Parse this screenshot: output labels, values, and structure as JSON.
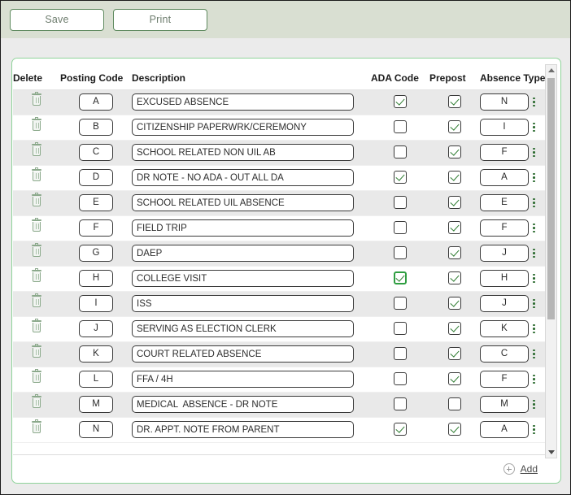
{
  "toolbar": {
    "save_label": "Save",
    "print_label": "Print"
  },
  "grid": {
    "columns": {
      "delete": "Delete",
      "posting_code": "Posting Code",
      "description": "Description",
      "ada_code": "ADA Code",
      "prepost": "Prepost",
      "absence_type": "Absence Type"
    },
    "rows": [
      {
        "delete_icon": "trash-icon",
        "posting_code": "A",
        "description": "EXCUSED ABSENCE",
        "ada_code": true,
        "prepost": true,
        "absence_type": "N",
        "ada_focused": false
      },
      {
        "delete_icon": "trash-icon",
        "posting_code": "B",
        "description": "CITIZENSHIP PAPERWRK/CEREMONY",
        "ada_code": false,
        "prepost": true,
        "absence_type": "I",
        "ada_focused": false
      },
      {
        "delete_icon": "trash-icon",
        "posting_code": "C",
        "description": "SCHOOL RELATED NON UIL AB",
        "ada_code": false,
        "prepost": true,
        "absence_type": "F",
        "ada_focused": false
      },
      {
        "delete_icon": "trash-icon",
        "posting_code": "D",
        "description": "DR NOTE - NO ADA - OUT ALL DA",
        "ada_code": true,
        "prepost": true,
        "absence_type": "A",
        "ada_focused": false
      },
      {
        "delete_icon": "trash-icon",
        "posting_code": "E",
        "description": "SCHOOL RELATED UIL ABSENCE",
        "ada_code": false,
        "prepost": true,
        "absence_type": "E",
        "ada_focused": false
      },
      {
        "delete_icon": "trash-icon",
        "posting_code": "F",
        "description": "FIELD TRIP",
        "ada_code": false,
        "prepost": true,
        "absence_type": "F",
        "ada_focused": false
      },
      {
        "delete_icon": "trash-icon",
        "posting_code": "G",
        "description": "DAEP",
        "ada_code": false,
        "prepost": true,
        "absence_type": "J",
        "ada_focused": false
      },
      {
        "delete_icon": "trash-icon",
        "posting_code": "H",
        "description": "COLLEGE VISIT",
        "ada_code": true,
        "prepost": true,
        "absence_type": "H",
        "ada_focused": true
      },
      {
        "delete_icon": "trash-icon",
        "posting_code": "I",
        "description": "ISS",
        "ada_code": false,
        "prepost": true,
        "absence_type": "J",
        "ada_focused": false
      },
      {
        "delete_icon": "trash-icon",
        "posting_code": "J",
        "description": "SERVING AS ELECTION CLERK",
        "ada_code": false,
        "prepost": true,
        "absence_type": "K",
        "ada_focused": false
      },
      {
        "delete_icon": "trash-icon",
        "posting_code": "K",
        "description": "COURT RELATED ABSENCE",
        "ada_code": false,
        "prepost": true,
        "absence_type": "C",
        "ada_focused": false
      },
      {
        "delete_icon": "trash-icon",
        "posting_code": "L",
        "description": "FFA / 4H",
        "ada_code": false,
        "prepost": true,
        "absence_type": "F",
        "ada_focused": false
      },
      {
        "delete_icon": "trash-icon",
        "posting_code": "M",
        "description": "MEDICAL  ABSENCE - DR NOTE",
        "ada_code": false,
        "prepost": false,
        "absence_type": "M",
        "ada_focused": false
      },
      {
        "delete_icon": "trash-icon",
        "posting_code": "N",
        "description": "DR. APPT. NOTE FROM PARENT",
        "ada_code": true,
        "prepost": true,
        "absence_type": "A",
        "ada_focused": false
      }
    ]
  },
  "footer": {
    "add_label": "Add",
    "add_icon": "plus-circle-icon"
  },
  "scrollbar": {
    "up_icon": "chevron-up-icon",
    "down_icon": "chevron-down-icon"
  },
  "colors": {
    "toolbar_bg": "#d9dfd2",
    "panel_border": "#8fd39a",
    "accent_green": "#2f7d32",
    "row_alt_bg": "#e9e9e9",
    "page_bg": "#ebebeb"
  }
}
